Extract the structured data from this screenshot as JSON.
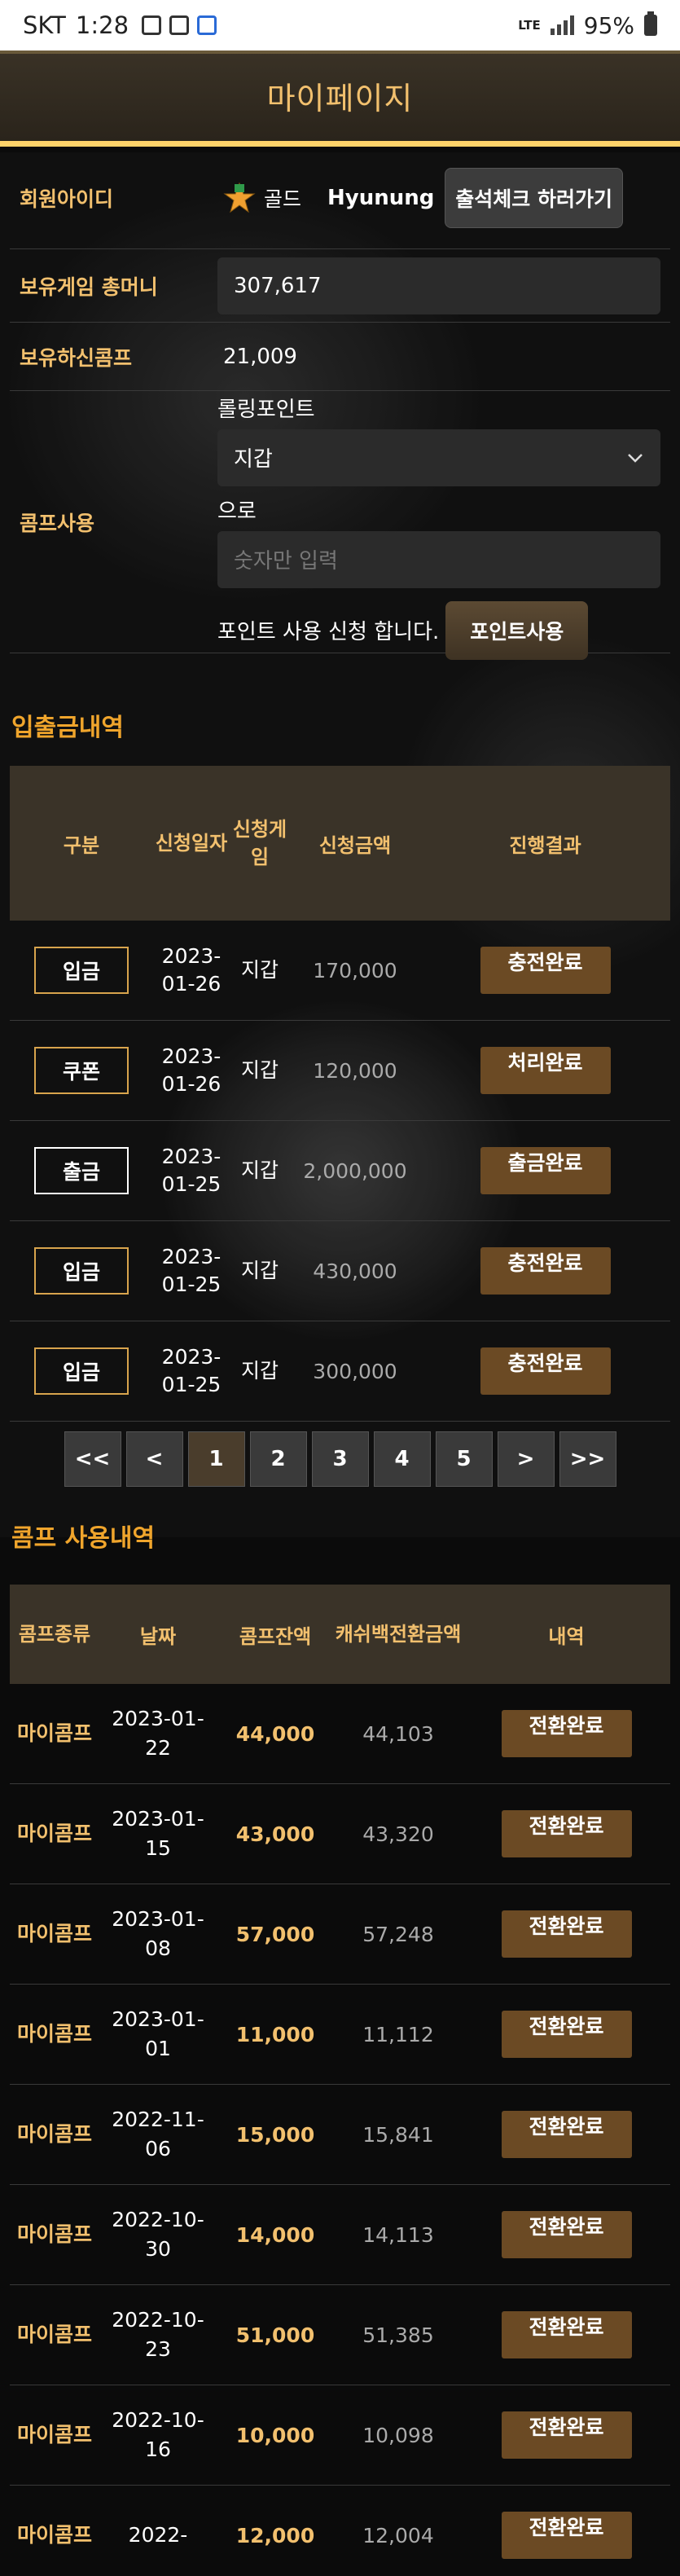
{
  "status_bar": {
    "carrier": "SKT",
    "time": "1:28",
    "network": "LTE",
    "battery": "95%"
  },
  "header": {
    "title": "마이페이지"
  },
  "member": {
    "id_label": "회원아이디",
    "grade": "골드",
    "user_id": "Hyunung",
    "attend_button": "출석체크 하러가기",
    "money_label": "보유게임 총머니",
    "money_value": "307,617",
    "comp_label": "보유하신콤프",
    "comp_value": "21,009"
  },
  "comp_use": {
    "label": "콤프사용",
    "rolling_caption": "롤링포인트",
    "selected_option": "지갑",
    "to_caption": "으로",
    "input_placeholder": "숫자만 입력",
    "apply_text": "포인트 사용 신청 합니다.",
    "apply_button": "포인트사용"
  },
  "deposit_history": {
    "title": "입출금내역",
    "headers": [
      "구분",
      "신청일자",
      "신청게임",
      "신청금액",
      "진행결과"
    ],
    "rows": [
      {
        "type": "입금",
        "date": "2023-01-26",
        "game": "지갑",
        "amount": "170,000",
        "status": "충전완료"
      },
      {
        "type": "쿠폰",
        "date": "2023-01-26",
        "game": "지갑",
        "amount": "120,000",
        "status": "처리완료"
      },
      {
        "type": "출금",
        "date": "2023-01-25",
        "game": "지갑",
        "amount": "2,000,000",
        "status": "출금완료"
      },
      {
        "type": "입금",
        "date": "2023-01-25",
        "game": "지갑",
        "amount": "430,000",
        "status": "충전완료"
      },
      {
        "type": "입금",
        "date": "2023-01-25",
        "game": "지갑",
        "amount": "300,000",
        "status": "충전완료"
      }
    ]
  },
  "pagination": {
    "first": "<<",
    "prev": "<",
    "pages": [
      "1",
      "2",
      "3",
      "4",
      "5"
    ],
    "next": ">",
    "last": ">>",
    "current": "1"
  },
  "comp_history": {
    "title": "콤프 사용내역",
    "headers": [
      "콤프종류",
      "날짜",
      "콤프잔액",
      "캐쉬백전환금액",
      "내역"
    ],
    "rows": [
      {
        "kind": "마이콤프",
        "date": "2023-01-22",
        "balance": "44,000",
        "cashback": "44,103",
        "detail": "전환완료"
      },
      {
        "kind": "마이콤프",
        "date": "2023-01-15",
        "balance": "43,000",
        "cashback": "43,320",
        "detail": "전환완료"
      },
      {
        "kind": "마이콤프",
        "date": "2023-01-08",
        "balance": "57,000",
        "cashback": "57,248",
        "detail": "전환완료"
      },
      {
        "kind": "마이콤프",
        "date": "2023-01-01",
        "balance": "11,000",
        "cashback": "11,112",
        "detail": "전환완료"
      },
      {
        "kind": "마이콤프",
        "date": "2022-11-06",
        "balance": "15,000",
        "cashback": "15,841",
        "detail": "전환완료"
      },
      {
        "kind": "마이콤프",
        "date": "2022-10-30",
        "balance": "14,000",
        "cashback": "14,113",
        "detail": "전환완료"
      },
      {
        "kind": "마이콤프",
        "date": "2022-10-23",
        "balance": "51,000",
        "cashback": "51,385",
        "detail": "전환완료"
      },
      {
        "kind": "마이콤프",
        "date": "2022-10-16",
        "balance": "10,000",
        "cashback": "10,098",
        "detail": "전환완료"
      },
      {
        "kind": "마이콤프",
        "date": "2022-",
        "balance": "12,000",
        "cashback": "12,004",
        "detail": "전환완료"
      }
    ]
  },
  "colors": {
    "accent_gold": "#f2c06e",
    "section_orange": "#f0a52c",
    "status_brown": "#6b4a24",
    "header_bar": "#ffd36a"
  }
}
